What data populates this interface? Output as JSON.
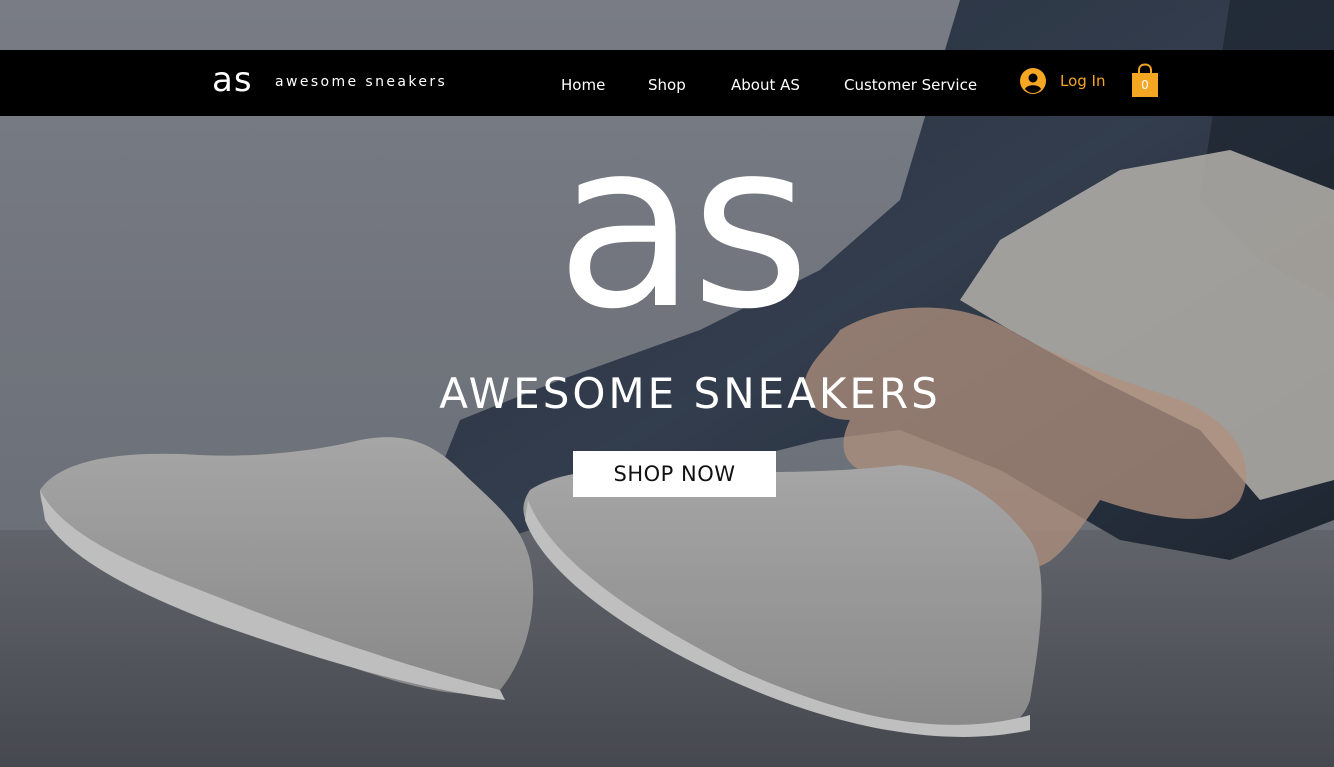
{
  "header": {
    "logo_mark": "as",
    "logo_text": "awesome sneakers",
    "nav": {
      "home": "Home",
      "shop": "Shop",
      "about": "About AS",
      "customer_service": "Customer Service"
    },
    "login_label": "Log In",
    "cart_count": "0"
  },
  "hero": {
    "mark": "as",
    "title": "AWESOME SNEAKERS",
    "cta_label": "SHOP NOW"
  },
  "colors": {
    "header_bg": "#000000",
    "accent": "#f5a623",
    "cta_bg": "#ffffff",
    "text_light": "#ffffff"
  },
  "icons": {
    "user": "user-avatar-icon",
    "cart": "shopping-bag-icon"
  }
}
